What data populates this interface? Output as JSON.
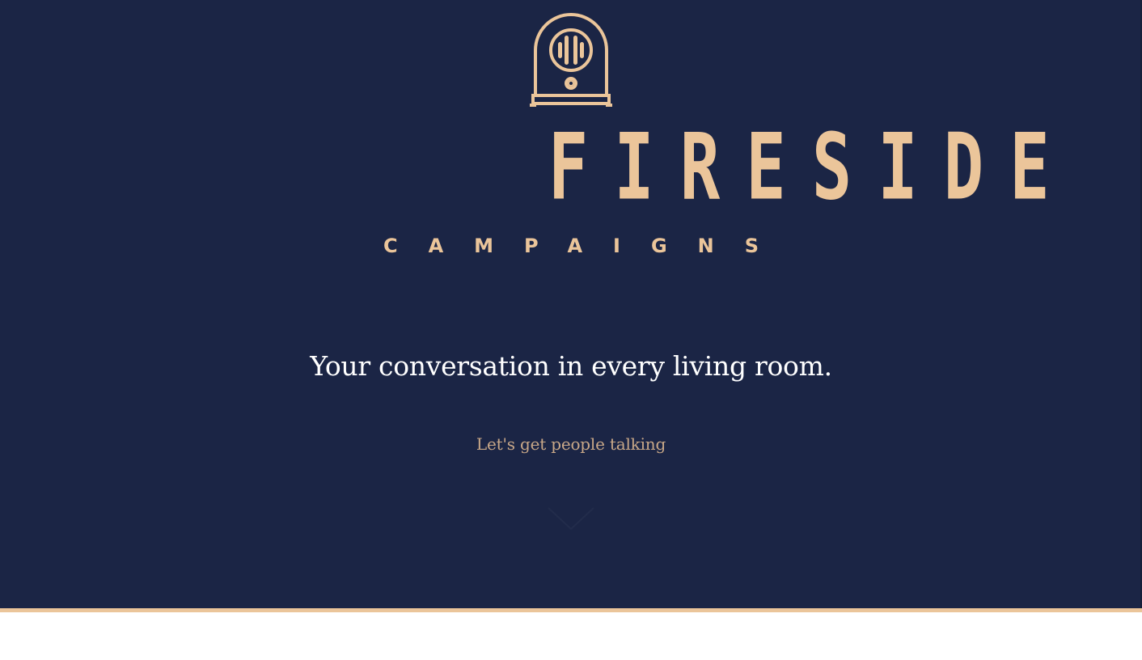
{
  "brand": {
    "name": "FIRESIDE",
    "subname": "CAMPAIGNS",
    "logo_icon": "radio-icon"
  },
  "hero": {
    "tagline": "Your conversation in every living room.",
    "cta_label": "Let's get people talking",
    "scroll_icon": "chevron-down-icon"
  },
  "colors": {
    "background": "#1b2545",
    "accent": "#ebc59a",
    "cta_text": "#c9a888",
    "tagline_text": "#ffffff",
    "below_fold": "#ffffff"
  }
}
